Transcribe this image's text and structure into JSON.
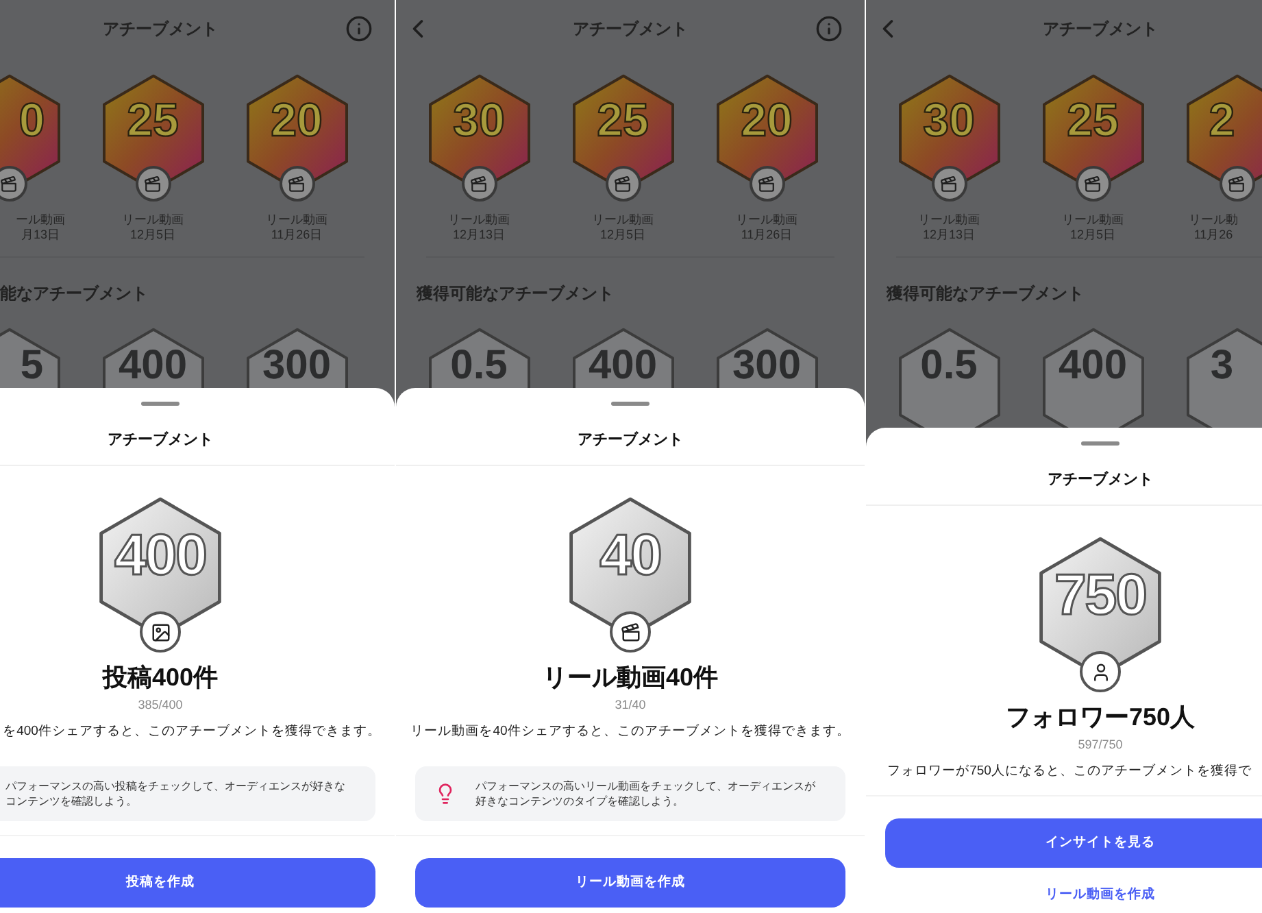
{
  "panels": [
    {
      "header": {
        "title": "アチーブメント"
      },
      "earned": [
        {
          "number": "0",
          "kind": "reel",
          "label": "ール動画",
          "date": "月13日"
        },
        {
          "number": "25",
          "kind": "reel",
          "label": "リール動画",
          "date": "12月5日"
        },
        {
          "number": "20",
          "kind": "reel",
          "label": "リール動画",
          "date": "11月26日"
        }
      ],
      "section_title": "能なアチーブメント",
      "available": [
        "5",
        "400",
        "300"
      ],
      "sheet": {
        "title": "アチーブメント",
        "badge": {
          "number": "400",
          "kind": "post"
        },
        "name": "投稿400件",
        "progress": "385/400",
        "description": "を400件シェアすると、このアチーブメントを獲得できます。",
        "tip": [
          "パフォーマンスの高い投稿をチェックして、オーディエンスが好きな",
          "コンテンツを確認しよう。"
        ],
        "primary_button": "投稿を作成"
      }
    },
    {
      "header": {
        "title": "アチーブメント"
      },
      "earned": [
        {
          "number": "30",
          "kind": "reel",
          "label": "リール動画",
          "date": "12月13日"
        },
        {
          "number": "25",
          "kind": "reel",
          "label": "リール動画",
          "date": "12月5日"
        },
        {
          "number": "20",
          "kind": "reel",
          "label": "リール動画",
          "date": "11月26日"
        }
      ],
      "section_title": "獲得可能なアチーブメント",
      "available": [
        "0.5",
        "400",
        "300"
      ],
      "sheet": {
        "title": "アチーブメント",
        "badge": {
          "number": "40",
          "kind": "reel"
        },
        "name": "リール動画40件",
        "progress": "31/40",
        "description": "リール動画を40件シェアすると、このアチーブメントを獲得できます。",
        "tip": [
          "パフォーマンスの高いリール動画をチェックして、オーディエンスが",
          "好きなコンテンツのタイプを確認しよう。"
        ],
        "primary_button": "リール動画を作成"
      }
    },
    {
      "header": {
        "title": "アチーブメント"
      },
      "earned": [
        {
          "number": "30",
          "kind": "reel",
          "label": "リール動画",
          "date": "12月13日"
        },
        {
          "number": "25",
          "kind": "reel",
          "label": "リール動画",
          "date": "12月5日"
        },
        {
          "number": "2",
          "kind": "reel",
          "label": "リール動",
          "date": "11月26"
        }
      ],
      "section_title": "獲得可能なアチーブメント",
      "available": [
        "0.5",
        "400",
        "3"
      ],
      "sheet": {
        "title": "アチーブメント",
        "badge": {
          "number": "750",
          "kind": "follower"
        },
        "name": "フォロワー750人",
        "progress": "597/750",
        "description": "フォロワーが750人になると、このアチーブメントを獲得で",
        "primary_button": "インサイトを見る",
        "secondary_link": "リール動画を作成"
      }
    }
  ]
}
